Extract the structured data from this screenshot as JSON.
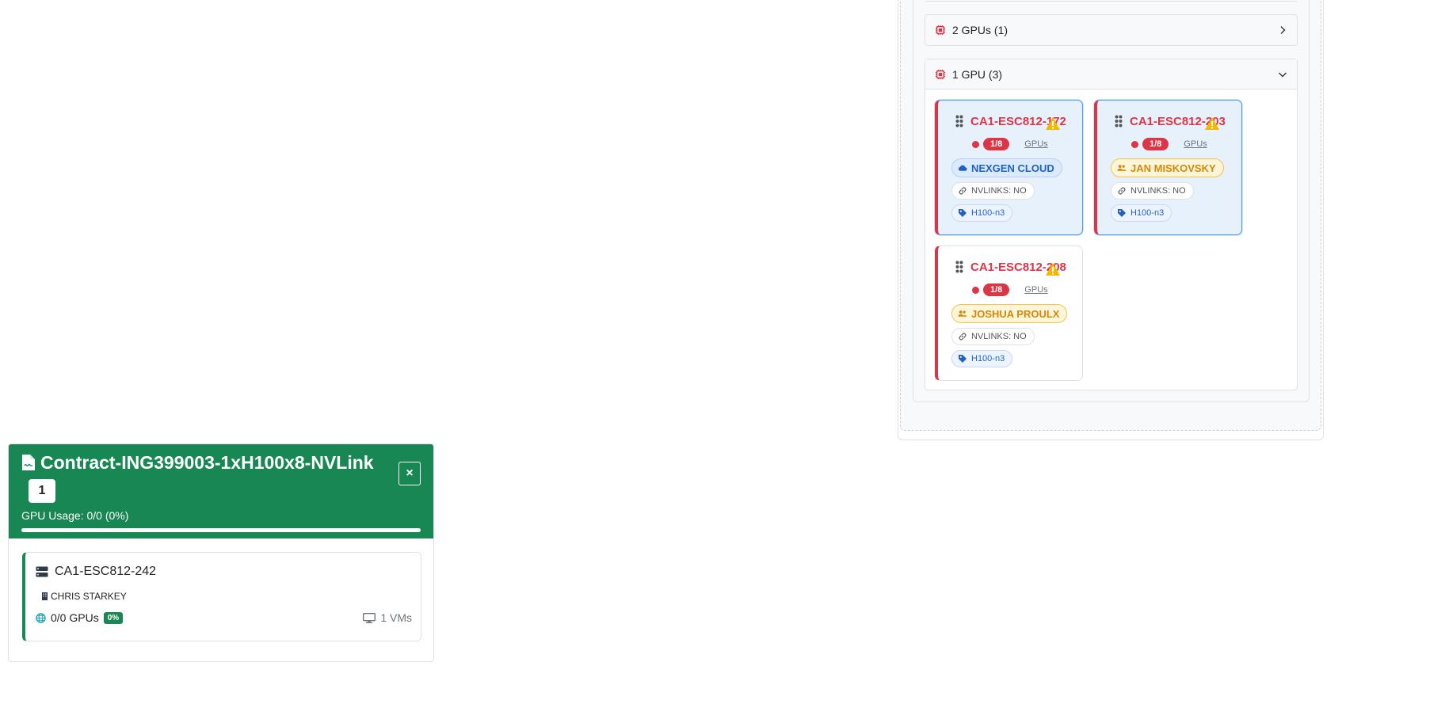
{
  "gpu_panel": {
    "groups": [
      {
        "label": "2 GPUs (1)",
        "state": "collapsed"
      },
      {
        "label": "1 GPU (3)",
        "state": "expanded"
      }
    ],
    "nodes": [
      {
        "name": "CA1-ESC812-172",
        "usage": "1/8",
        "gpus_label": "GPUs",
        "owner_type": "cloud",
        "owner": "NEXGEN CLOUD",
        "nvlinks": "NVLINKS: NO",
        "tag": "H100-n3",
        "selected": true
      },
      {
        "name": "CA1-ESC812-203",
        "usage": "1/8",
        "gpus_label": "GPUs",
        "owner_type": "user",
        "owner": "JAN MISKOVSKY",
        "nvlinks": "NVLINKS: NO",
        "tag": "H100-n3",
        "selected": true
      },
      {
        "name": "CA1-ESC812-208",
        "usage": "1/8",
        "gpus_label": "GPUs",
        "owner_type": "user",
        "owner": "JOSHUA PROULX",
        "nvlinks": "NVLINKS: NO",
        "tag": "H100-n3",
        "selected": false
      }
    ],
    "colors": {
      "alert_red": "#dc3545",
      "selected_bg": "#e6f1fc",
      "cloud_blue": "#1e63c4",
      "user_amber": "#d48806"
    }
  },
  "contract": {
    "title": "Contract-ING399003-1xH100x8-NVLink",
    "count": "1",
    "close_label": "×",
    "usage_text": "GPU Usage: 0/0 (0%)",
    "usage_fraction": 0,
    "header_color": "#198754",
    "server": {
      "name": "CA1-ESC812-242",
      "owner": "CHRIS STARKEY",
      "gpus": "0/0 GPUs",
      "gpu_percent": "0%",
      "vms": "1 VMs"
    }
  }
}
